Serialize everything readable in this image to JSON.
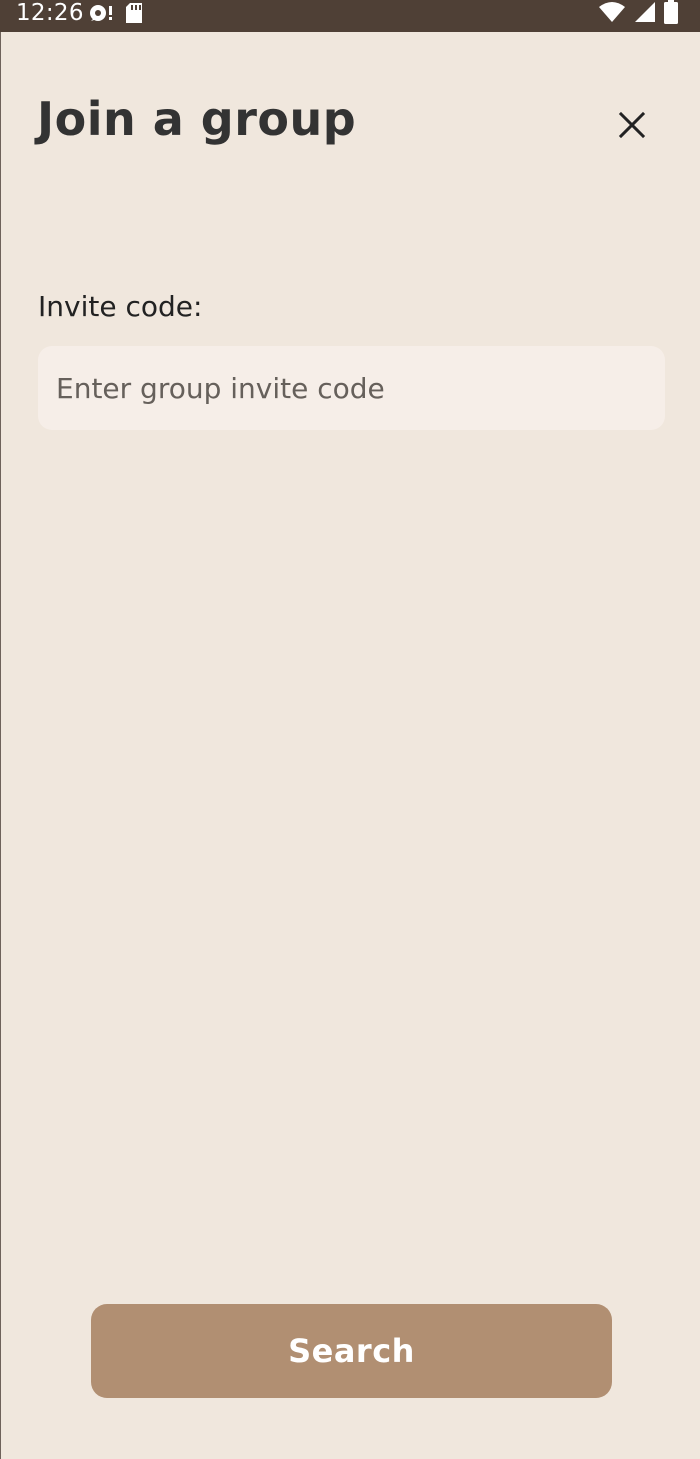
{
  "status_bar": {
    "time": "12:26",
    "icons": [
      "sync-alert-icon",
      "sd-card-icon",
      "wifi-icon",
      "cell-signal-icon",
      "battery-icon"
    ]
  },
  "dialog": {
    "title": "Join a group",
    "close_icon": "close-icon",
    "invite_label": "Invite code:",
    "invite_input": {
      "value": "",
      "placeholder": "Enter group invite code"
    },
    "search_label": "Search"
  },
  "colors": {
    "status_bar_bg": "#4F4036",
    "background": "#F0E7DD",
    "input_bg": "#F6EEE8",
    "button_bg": "#B18F72",
    "title_text": "#333333"
  }
}
